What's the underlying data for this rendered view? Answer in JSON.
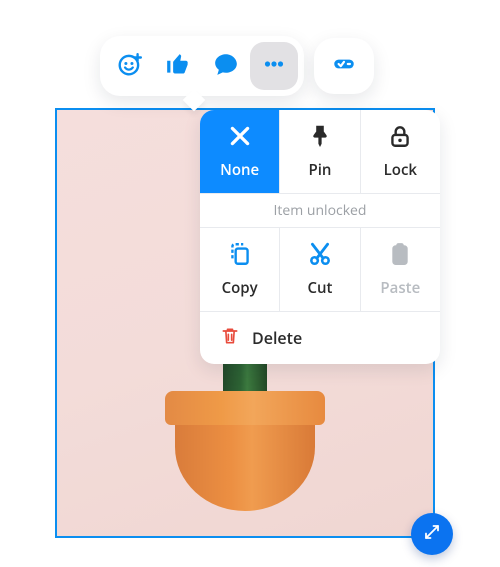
{
  "toolbar": {
    "icons": [
      "add-reaction",
      "like",
      "comment",
      "more"
    ],
    "extra_icon": "annotate"
  },
  "popover": {
    "row1": [
      {
        "name": "none",
        "label": "None",
        "icon": "x-icon",
        "state": "selected"
      },
      {
        "name": "pin",
        "label": "Pin",
        "icon": "pin-icon",
        "state": "normal"
      },
      {
        "name": "lock",
        "label": "Lock",
        "icon": "lock-icon",
        "state": "normal"
      }
    ],
    "status": "Item unlocked",
    "row2": [
      {
        "name": "copy",
        "label": "Copy",
        "icon": "copy-icon",
        "state": "normal"
      },
      {
        "name": "cut",
        "label": "Cut",
        "icon": "cut-icon",
        "state": "normal"
      },
      {
        "name": "paste",
        "label": "Paste",
        "icon": "paste-icon",
        "state": "disabled"
      }
    ],
    "delete_label": "Delete"
  },
  "image": {
    "alt": "cactus in orange pot"
  }
}
